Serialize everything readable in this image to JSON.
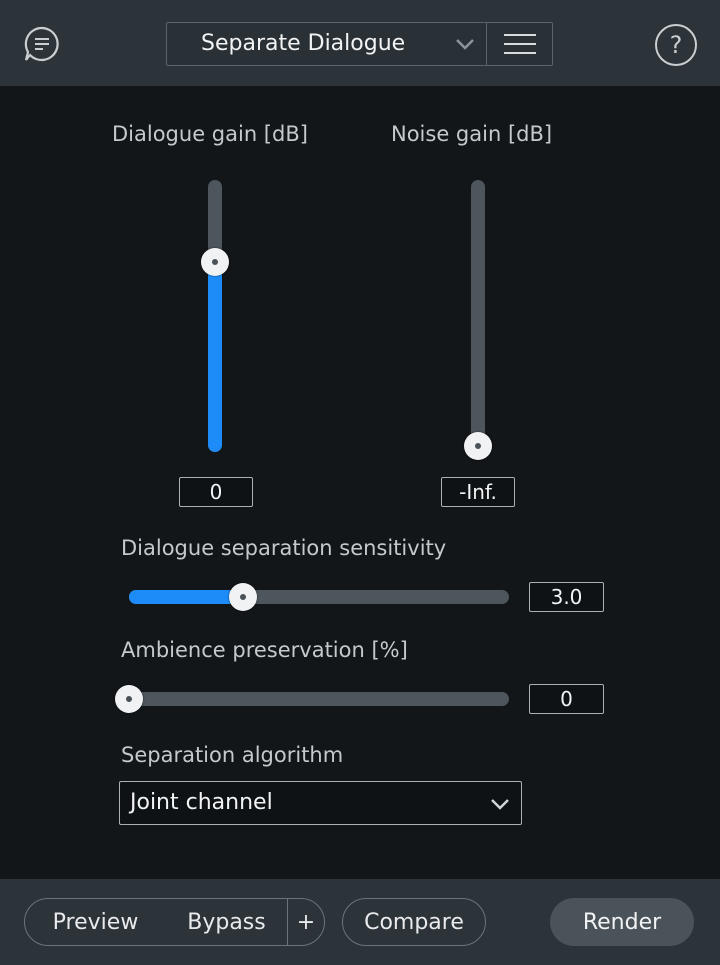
{
  "header": {
    "module_name": "Separate Dialogue",
    "icons": {
      "chat": "chat-bubble-icon",
      "help": "question-mark-icon",
      "menu": "hamburger-menu-icon",
      "dropdown": "chevron-down-icon"
    },
    "help_glyph": "?"
  },
  "dialogue_gain": {
    "label": "Dialogue gain [dB]",
    "value": "0",
    "level_fraction": 0.7
  },
  "noise_gain": {
    "label": "Noise gain [dB]",
    "value": "-Inf.",
    "level_fraction": 0.0
  },
  "sensitivity": {
    "label": "Dialogue separation sensitivity",
    "value": "3.0",
    "level_fraction": 0.3
  },
  "ambience": {
    "label": "Ambience preservation [%]",
    "value": "0",
    "level_fraction": 0.0
  },
  "algorithm": {
    "label": "Separation algorithm",
    "selected": "Joint channel"
  },
  "footer": {
    "preview": "Preview",
    "bypass": "Bypass",
    "plus": "+",
    "compare": "Compare",
    "render": "Render"
  },
  "colors": {
    "accent": "#1d8cf8",
    "background": "#121619",
    "panel": "#2c3339"
  }
}
